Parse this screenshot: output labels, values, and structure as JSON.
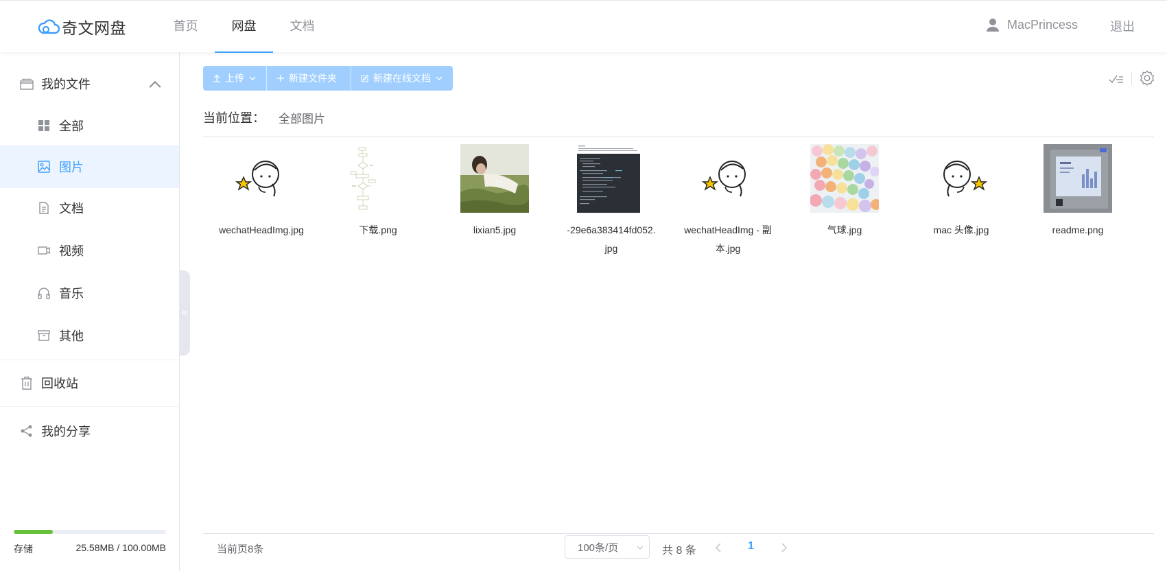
{
  "header": {
    "logo_text": "奇文网盘",
    "nav": [
      {
        "label": "首页"
      },
      {
        "label": "网盘"
      },
      {
        "label": "文档"
      }
    ],
    "active_nav": "网盘",
    "username": "MacPrincess",
    "logout_label": "退出"
  },
  "sidebar": {
    "my_files": "我的文件",
    "items": [
      {
        "label": "全部"
      },
      {
        "label": "图片"
      },
      {
        "label": "文档"
      },
      {
        "label": "视频"
      },
      {
        "label": "音乐"
      },
      {
        "label": "其他"
      }
    ],
    "active_item": "图片",
    "recycle": "回收站",
    "share": "我的分享",
    "collapse_glyph": "«",
    "storage": {
      "label": "存储",
      "value": "25.58MB / 100.00MB",
      "used_fraction": 0.2558,
      "color": "#67c23a"
    }
  },
  "toolbar": {
    "upload": "上传",
    "new_folder": "新建文件夹",
    "new_doc": "新建在线文档"
  },
  "breadcrumb": {
    "label": "当前位置：",
    "value": "全部图片"
  },
  "files": [
    {
      "name": "wechatHeadImg.jpg",
      "thumb": "avatar-star-left"
    },
    {
      "name": "下载.png",
      "thumb": "flowchart"
    },
    {
      "name": "lixian5.jpg",
      "thumb": "photo-grass"
    },
    {
      "name": "-29e6a383414fd052.jpg",
      "thumb": "screenshot-dark"
    },
    {
      "name": "wechatHeadImg - 副本.jpg",
      "thumb": "avatar-star-left"
    },
    {
      "name": "气球.jpg",
      "thumb": "balloons"
    },
    {
      "name": "mac 头像.jpg",
      "thumb": "avatar-star-right"
    },
    {
      "name": "readme.png",
      "thumb": "screenshot-gray"
    }
  ],
  "pagination": {
    "page_info": "当前页8条",
    "page_size": "100条/页",
    "total": "共 8 条",
    "current_page": "1"
  },
  "colors": {
    "accent": "#409eff",
    "toolbar_bg": "#a0cfff",
    "active_bg": "#ecf5ff"
  }
}
